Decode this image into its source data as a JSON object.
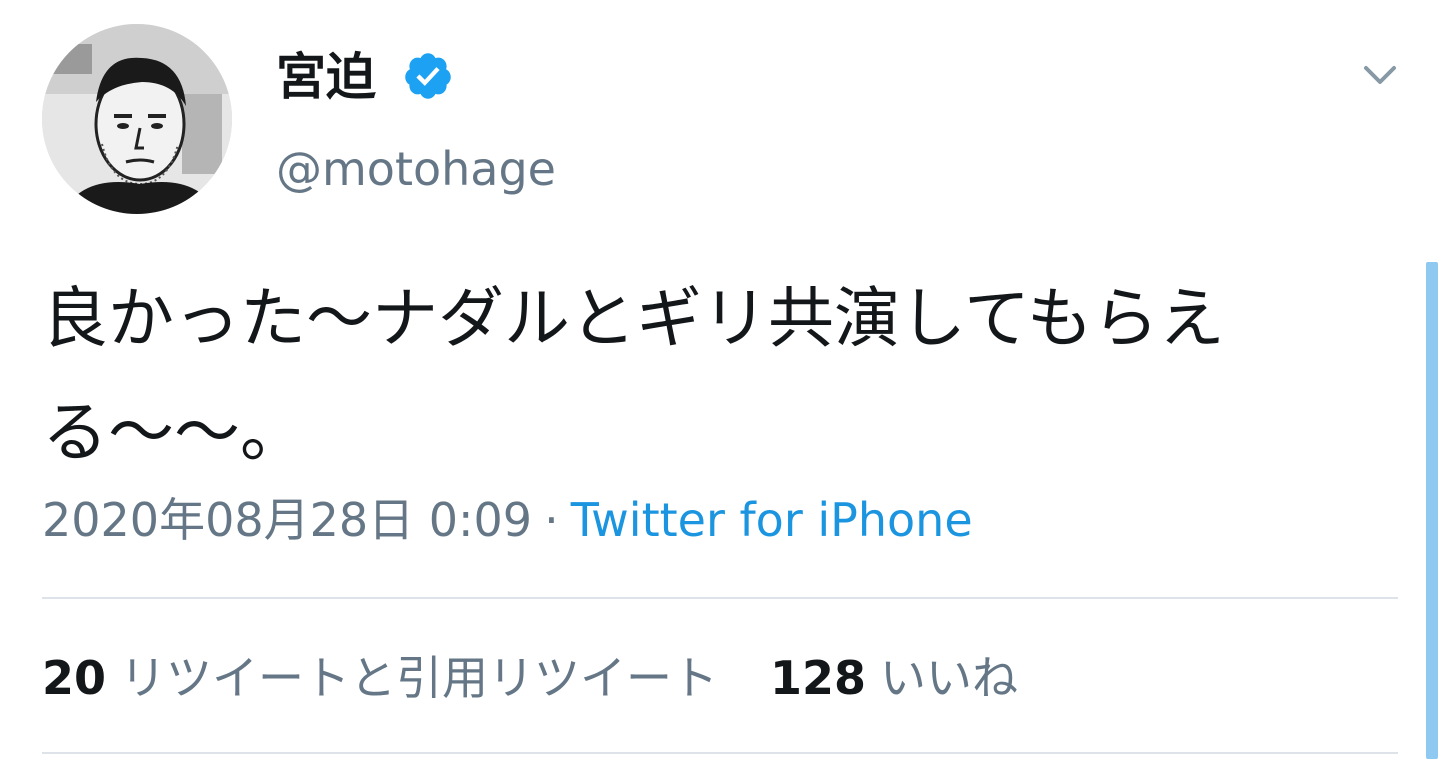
{
  "author": {
    "display_name": "宮迫",
    "handle": "@motohage",
    "verified": true
  },
  "tweet": {
    "text": "良かった〜ナダルとギリ共演してもらえる〜〜。",
    "timestamp": "2020年08月28日 0:09",
    "separator": "·",
    "source": "Twitter for iPhone"
  },
  "stats": {
    "retweets_count": "20",
    "retweets_label": "リツイートと引用リツイート",
    "likes_count": "128",
    "likes_label": "いいね"
  },
  "colors": {
    "text_primary": "#14171a",
    "text_secondary": "#657786",
    "link_blue": "#1b95e0",
    "verified_blue": "#1da1f2",
    "divider": "#dde3e8"
  },
  "icons": {
    "verified": "verified-badge-icon",
    "menu": "chevron-down-icon"
  }
}
